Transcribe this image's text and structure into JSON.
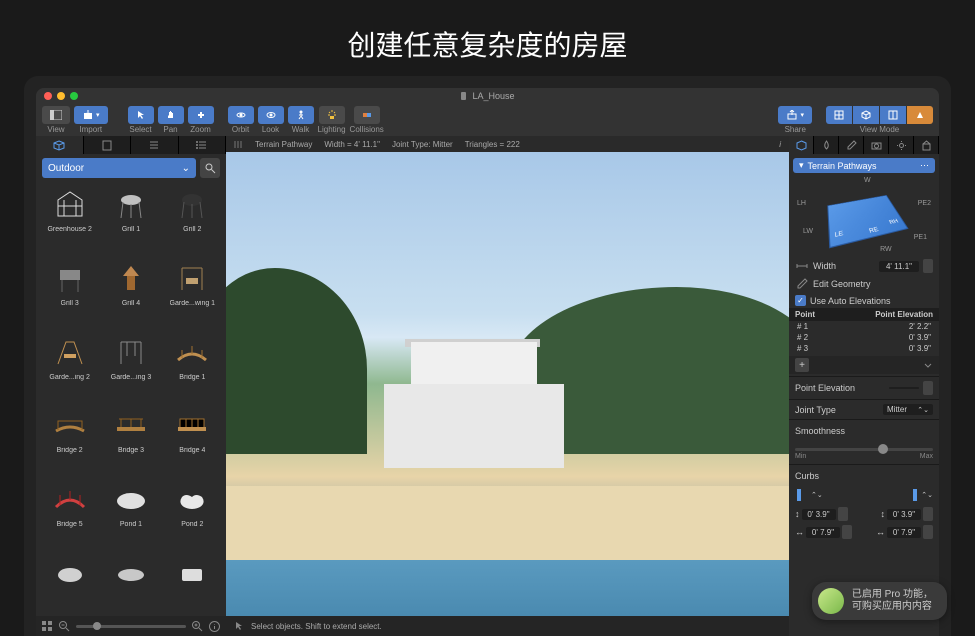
{
  "promo_title": "创建任意复杂度的房屋",
  "document_name": "LA_House",
  "toolbar": {
    "view": "View",
    "import": "Import",
    "select": "Select",
    "pan": "Pan",
    "zoom": "Zoom",
    "orbit": "Orbit",
    "look": "Look",
    "walk": "Walk",
    "lighting": "Lighting",
    "collisions": "Collisions",
    "share": "Share",
    "view_mode": "View Mode"
  },
  "library": {
    "category": "Outdoor",
    "items": [
      {
        "label": "Greenhouse 2"
      },
      {
        "label": "Grill 1"
      },
      {
        "label": "Grill 2"
      },
      {
        "label": "Grill 3"
      },
      {
        "label": "Grill 4"
      },
      {
        "label": "Garde...wing 1"
      },
      {
        "label": "Garde...ing 2"
      },
      {
        "label": "Garde...ing 3"
      },
      {
        "label": "Bridge 1"
      },
      {
        "label": "Bridge 2"
      },
      {
        "label": "Bridge 3"
      },
      {
        "label": "Bridge 4"
      },
      {
        "label": "Bridge 5"
      },
      {
        "label": "Pond 1"
      },
      {
        "label": "Pond 2"
      }
    ]
  },
  "info_bar": {
    "object": "Terrain Pathway",
    "width": "Width = 4' 11.1\"",
    "joint": "Joint Type: Mitter",
    "triangles": "Triangles = 222"
  },
  "status_center": "Select objects. Shift to extend select.",
  "inspector": {
    "section_name": "Terrain Pathways",
    "diagram_labels": {
      "w": "W",
      "le": "LE",
      "re": "RE",
      "rh": "RH",
      "lh": "LH",
      "lw": "LW",
      "rw": "RW",
      "pe1": "PE1",
      "pe2": "PE2"
    },
    "width_label": "Width",
    "width_value": "4' 11.1\"",
    "edit_geometry": "Edit Geometry",
    "use_auto_elevations": "Use Auto Elevations",
    "table_headers": {
      "point": "Point",
      "elevation": "Point Elevation"
    },
    "table_rows": [
      {
        "point": "# 1",
        "elev": "2' 2.2\""
      },
      {
        "point": "# 2",
        "elev": "0' 3.9\""
      },
      {
        "point": "# 3",
        "elev": "0' 3.9\""
      }
    ],
    "point_elevation": "Point Elevation",
    "joint_type_label": "Joint Type",
    "joint_type_value": "Mitter",
    "smoothness": "Smoothness",
    "smooth_min": "Min",
    "smooth_max": "Max",
    "curbs": "Curbs",
    "curb_values": {
      "l_h": "0' 3.9\"",
      "r_h": "0' 3.9\"",
      "l_w": "0' 7.9\"",
      "r_w": "0' 7.9\""
    }
  },
  "pro_badge": {
    "line1": "已启用 Pro 功能，",
    "line2": "可购买应用内内容"
  }
}
